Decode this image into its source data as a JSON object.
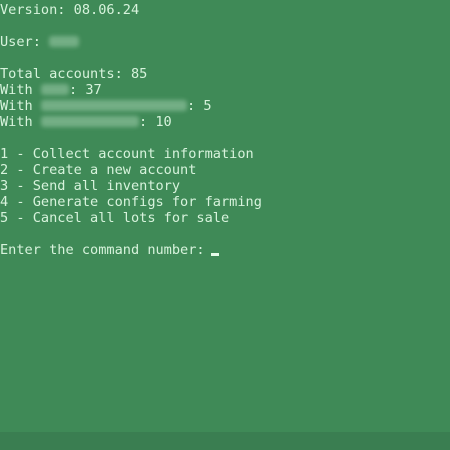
{
  "version": {
    "label": "Version:",
    "value": "08.06.24"
  },
  "user": {
    "label": "User:"
  },
  "stats": {
    "total_label": "Total accounts:",
    "total_value": "85",
    "with_label": "With",
    "row1_value": "37",
    "row2_value": "5",
    "row3_value": "10"
  },
  "menu": {
    "items": [
      "1 - Collect account information",
      "2 - Create a new account",
      "3 - Send all inventory",
      "4 - Generate configs for farming",
      "5 - Cancel all lots for sale"
    ]
  },
  "prompt": {
    "text": "Enter the command number:"
  }
}
